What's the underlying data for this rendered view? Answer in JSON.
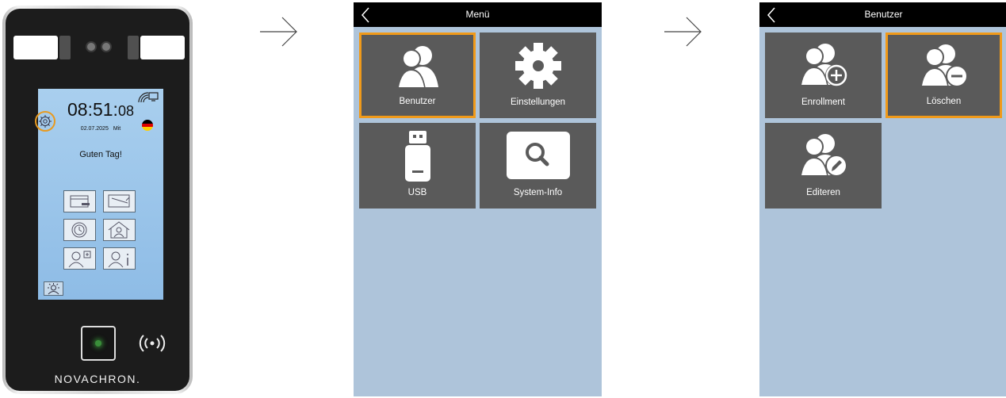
{
  "device": {
    "time_hm": "08:51:",
    "time_s": "08",
    "date": "02.07.2025",
    "weekday": "Mit",
    "greeting": "Guten Tag!",
    "brand": "NOVACHRON.",
    "flag": [
      "#000000",
      "#dd0000",
      "#ffce00"
    ]
  },
  "menu_screen": {
    "title": "Menü",
    "tiles": [
      {
        "label": "Benutzer",
        "icon": "users-icon",
        "selected": true
      },
      {
        "label": "Einstellungen",
        "icon": "gear-icon",
        "selected": false
      },
      {
        "label": "USB",
        "icon": "usb-stick-icon",
        "selected": false
      },
      {
        "label": "System-Info",
        "icon": "magnifier-icon",
        "selected": false
      }
    ]
  },
  "user_screen": {
    "title": "Benutzer",
    "tiles": [
      {
        "label": "Enrollment",
        "icon": "user-add-icon",
        "selected": false
      },
      {
        "label": "Löschen",
        "icon": "user-remove-icon",
        "selected": true
      },
      {
        "label": "Editeren",
        "icon": "user-edit-icon",
        "selected": false
      }
    ]
  },
  "colors": {
    "accent": "#f09a1a",
    "tile": "#5a5a5a",
    "screen_bg": "#aec4da",
    "topbar": "#000000"
  }
}
